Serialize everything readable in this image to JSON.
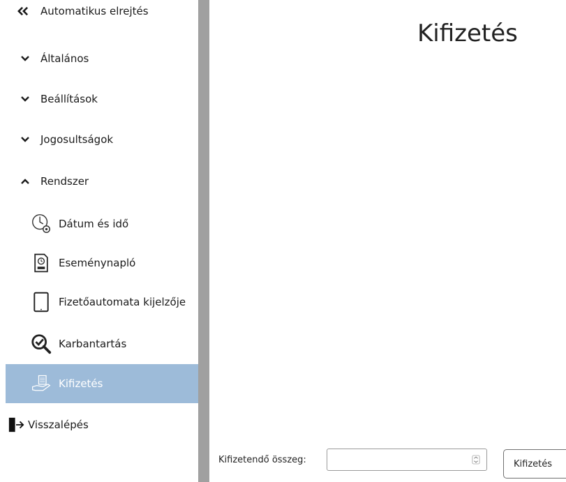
{
  "sidebar": {
    "auto_hide": "Automatikus elrejtés",
    "groups": [
      {
        "label": "Általános",
        "state": "collapsed"
      },
      {
        "label": "Beállítások",
        "state": "collapsed"
      },
      {
        "label": "Jogosultságok",
        "state": "collapsed"
      },
      {
        "label": "Rendszer",
        "state": "expanded"
      }
    ],
    "items": [
      {
        "label": "Dátum és idő",
        "icon": "clock-gear-icon"
      },
      {
        "label": "Eseménynapló",
        "icon": "log-file-icon"
      },
      {
        "label": "Fizetőautomata kijelzője",
        "icon": "tablet-icon"
      },
      {
        "label": "Karbantartás",
        "icon": "check-search-icon"
      },
      {
        "label": "Kifizetés",
        "icon": "payment-hand-icon",
        "active": true
      }
    ],
    "logout": "Visszalépés",
    "active_color": "#9dbbd9"
  },
  "main": {
    "title": "Kifizetés",
    "amount_label": "Kifizetendő összeg:",
    "amount_value": "",
    "pay_button": "Kifizetés"
  }
}
